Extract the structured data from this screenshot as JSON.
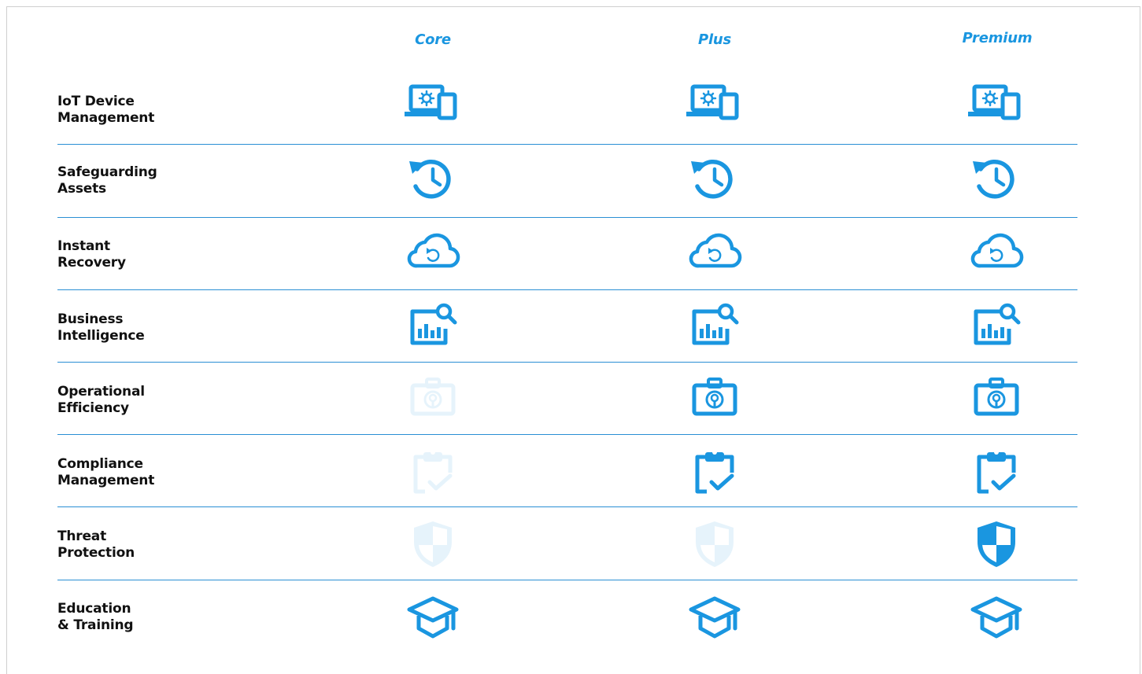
{
  "tiers": [
    {
      "label": "Core"
    },
    {
      "label": "Plus"
    },
    {
      "label": "Premium"
    }
  ],
  "accent_color": "#1a96e0",
  "rows": [
    {
      "label_line1": "IoT Device",
      "label_line2": "Management",
      "icon": "device-management-icon",
      "included": [
        true,
        true,
        true
      ]
    },
    {
      "label_line1": "Safeguarding",
      "label_line2": "Assets",
      "icon": "history-clock-icon",
      "included": [
        true,
        true,
        true
      ]
    },
    {
      "label_line1": "Instant",
      "label_line2": "Recovery",
      "icon": "cloud-restore-icon",
      "included": [
        true,
        true,
        true
      ]
    },
    {
      "label_line1": "Business",
      "label_line2": "Intelligence",
      "icon": "analytics-search-icon",
      "included": [
        true,
        true,
        true
      ]
    },
    {
      "label_line1": "Operational",
      "label_line2": "Efficiency",
      "icon": "briefcase-gear-icon",
      "included": [
        false,
        true,
        true
      ]
    },
    {
      "label_line1": "Compliance",
      "label_line2": "Management",
      "icon": "clipboard-check-icon",
      "included": [
        false,
        true,
        true
      ]
    },
    {
      "label_line1": "Threat",
      "label_line2": "Protection",
      "icon": "shield-icon",
      "included": [
        false,
        false,
        true
      ]
    },
    {
      "label_line1": "Education",
      "label_line2": "& Training",
      "icon": "graduation-cap-icon",
      "included": [
        true,
        true,
        true
      ]
    }
  ]
}
